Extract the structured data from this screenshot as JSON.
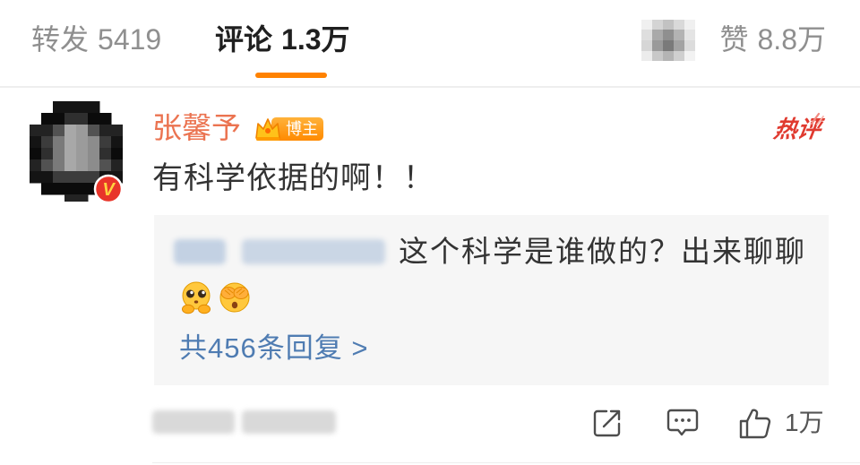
{
  "colors": {
    "accent_orange": "#ff8200",
    "username_orange": "#eb7350",
    "hot_red": "#e03a2f",
    "link_blue": "#4f7cb2",
    "text_primary": "#333333",
    "text_secondary": "#8f8f8f",
    "reply_bg": "#f6f6f6"
  },
  "tabs": {
    "repost": {
      "label": "转发",
      "count": "5419"
    },
    "comments": {
      "label": "评论",
      "count": "1.3万",
      "active": true
    },
    "likes": {
      "label": "赞",
      "count": "8.8万"
    }
  },
  "comment": {
    "author": {
      "name": "张馨予",
      "verified_badge": "V",
      "role_badge": "博主"
    },
    "hot_label": "热评",
    "text": "有科学依据的啊！！",
    "reply_preview": {
      "text": "这个科学是谁做的？出来聊聊",
      "emojis": [
        "pleading-face-emoji",
        "face-covering-eyes-emoji"
      ],
      "more_replies": "共456条回复 >"
    },
    "actions": {
      "share_icon": "share-icon",
      "reply_icon": "comment-icon",
      "like_icon": "thumbs-up-icon",
      "like_count": "1万"
    }
  }
}
